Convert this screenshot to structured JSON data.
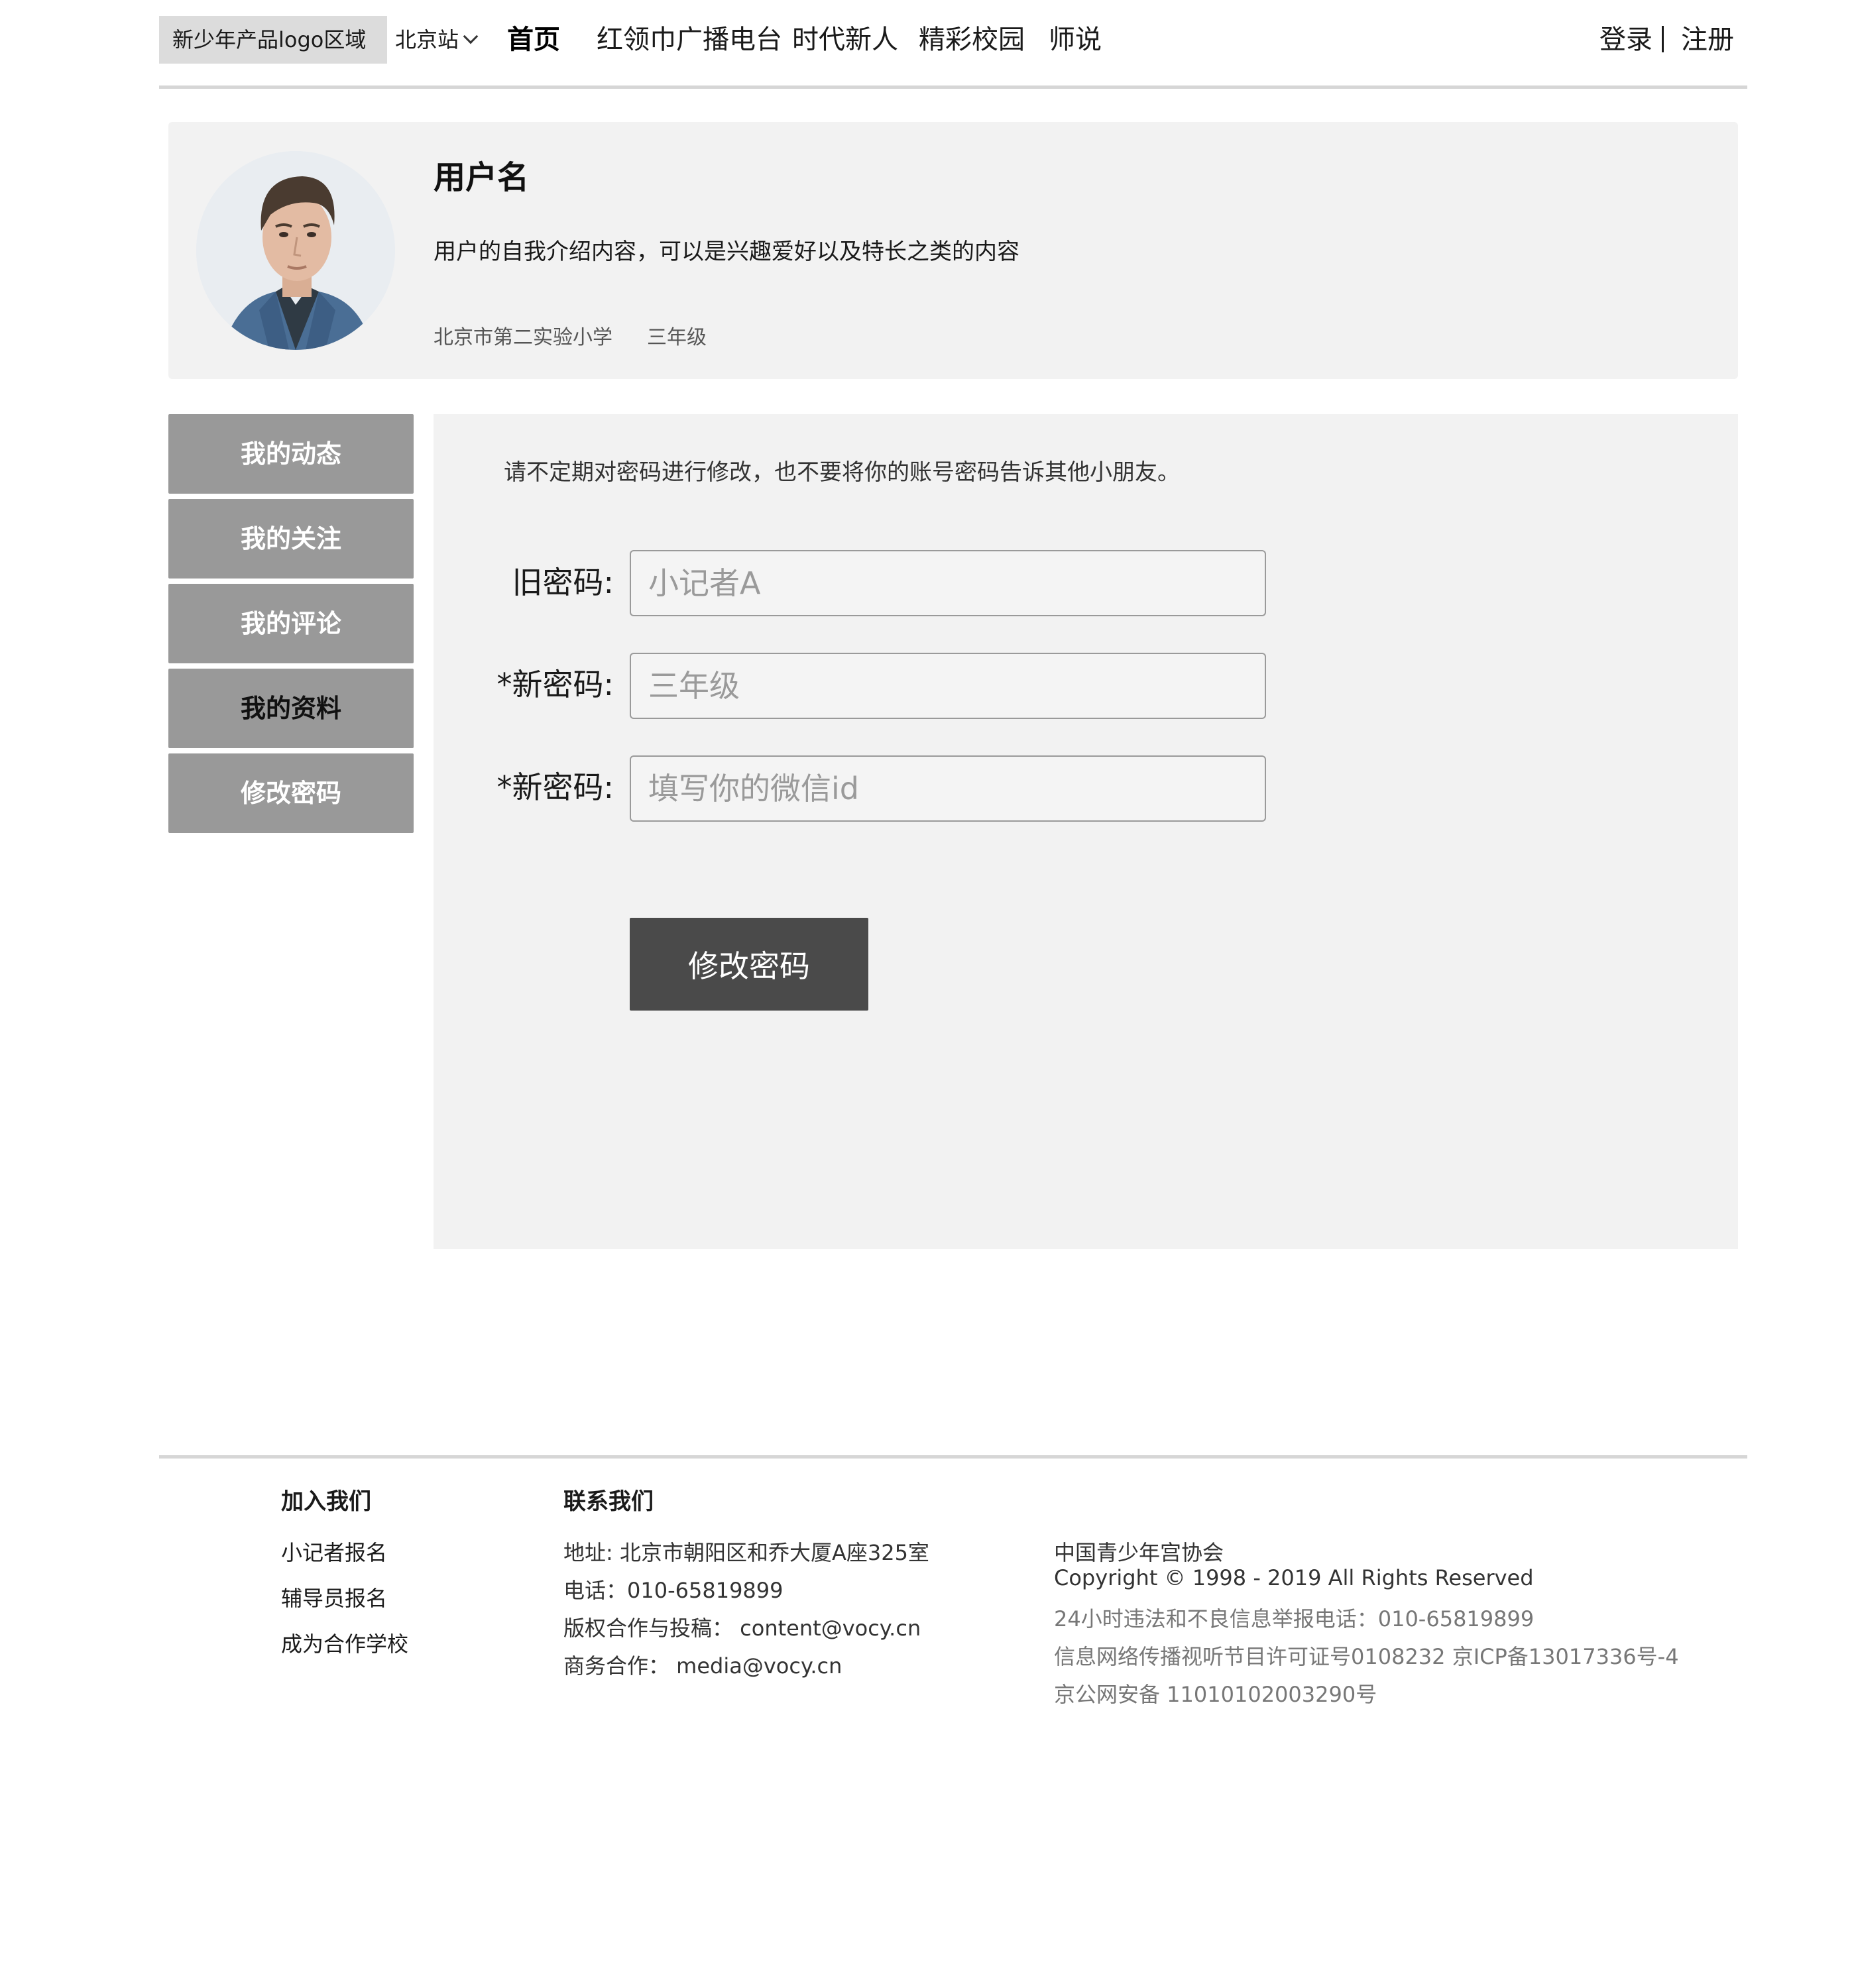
{
  "header": {
    "logo": "新少年产品logo区域",
    "city": "北京站",
    "nav": [
      "首页",
      "红领巾广播电台",
      "时代新人",
      "精彩校园",
      "师说"
    ],
    "login": "登录",
    "register": "注册"
  },
  "profile": {
    "username": "用户名",
    "bio": "用户的自我介绍内容，可以是兴趣爱好以及特长之类的内容",
    "school": "北京市第二实验小学",
    "grade": "三年级"
  },
  "sidebar": {
    "items": [
      "我的动态",
      "我的关注",
      "我的评论",
      "我的资料",
      "修改密码"
    ]
  },
  "form": {
    "notice": "请不定期对密码进行修改，也不要将你的账号密码告诉其他小朋友。",
    "old_label": "旧密码:",
    "old_placeholder": "小记者A",
    "new_label": "*新密码:",
    "new_placeholder": "三年级",
    "confirm_label": "*新密码:",
    "confirm_placeholder": "填写你的微信id",
    "submit": "修改密码"
  },
  "footer": {
    "join_title": "加入我们",
    "join_links": [
      "小记者报名",
      "辅导员报名",
      "成为合作学校"
    ],
    "contact_title": "联系我们",
    "contact": [
      "地址: 北京市朝阳区和乔大厦A座325室",
      "电话：010-65819899",
      "版权合作与投稿：  content@vocy.cn",
      "商务合作：  media@vocy.cn"
    ],
    "org": "中国青少年宫协会",
    "copyright": "Copyright © 1998 - 2019 All Rights Reserved",
    "hotline": "24小时违法和不良信息举报电话：010-65819899",
    "license": "信息网络传播视听节目许可证号0108232 京ICP备13017336号-4",
    "security": "京公网安备 11010102003290号"
  },
  "icons": {
    "city_dropdown": "chevron-down-icon",
    "avatar": "user-avatar-photo"
  }
}
